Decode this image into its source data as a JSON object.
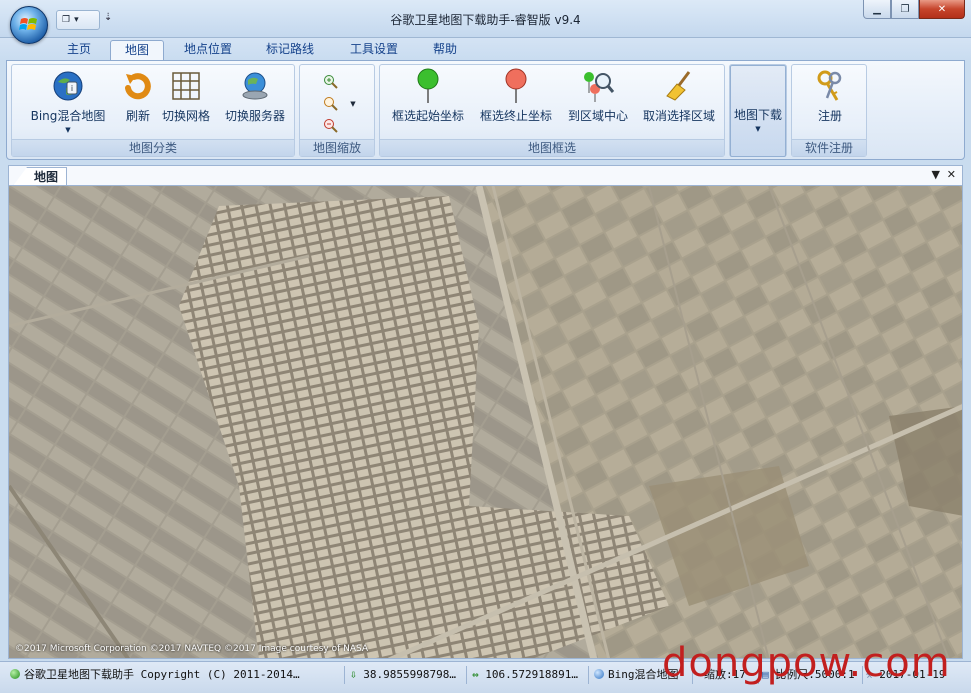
{
  "window": {
    "title": "谷歌卫星地图下载助手-睿智版 v9.4"
  },
  "tabs": [
    "主页",
    "地图",
    "地点位置",
    "标记路线",
    "工具设置",
    "帮助"
  ],
  "ribbon": {
    "groups": {
      "map_type": {
        "label": "地图分类"
      },
      "zoom": {
        "label": "地图缩放"
      },
      "select": {
        "label": "地图框选"
      },
      "download": {
        "label": ""
      },
      "register": {
        "label": "软件注册"
      }
    },
    "buttons": {
      "bing": "Bing混合地图",
      "refresh": "刷新",
      "grid": "切换网格",
      "server": "切换服务器",
      "select_start": "框选起始坐标",
      "select_end": "框选终止坐标",
      "region_center": "到区域中心",
      "cancel_select": "取消选择区域",
      "download": "地图下载",
      "register": "注册"
    }
  },
  "doc": {
    "tab": "地图"
  },
  "map": {
    "copyright": "©2017 Microsoft Corporation  ©2017 NAVTEQ  ©2017 Image courtesy of NASA"
  },
  "status": {
    "app": "谷歌卫星地图下载助手 Copyright (C) 2011-2014…",
    "lat": "38.9855998798…",
    "lng": "106.572918891…",
    "source": "Bing混合地图",
    "zoom": "缩放:17",
    "scale": "比例尺:5000:1",
    "date": "2017-01-19"
  },
  "watermark": {
    "text": "dongpow.com"
  },
  "colors": {
    "accent": "#15428b",
    "ribbon": "#dae6f4",
    "close": "#c6452c",
    "watermark": "#c21f1f"
  }
}
